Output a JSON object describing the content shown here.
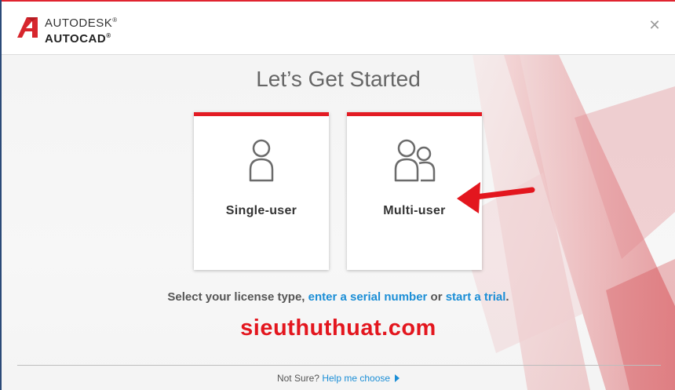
{
  "header": {
    "brand": "AUTODESK",
    "brand_mark": "®",
    "product": "AUTOCAD",
    "product_mark": "®",
    "close_icon": "close-icon"
  },
  "main": {
    "title": "Let’s Get Started",
    "cards": [
      {
        "label": "Single-user",
        "icon": "single-user-icon"
      },
      {
        "label": "Multi-user",
        "icon": "multi-user-icon"
      }
    ],
    "prompt": {
      "text": "Select your license type,",
      "serial_link": "enter a serial number",
      "or": "or",
      "trial_link": "start a trial",
      "end": "."
    }
  },
  "watermark": "sieuthuthuat.com",
  "footer": {
    "not_sure": "Not Sure?",
    "help_link": "Help me choose"
  },
  "colors": {
    "accent_red": "#e31b23",
    "link_blue": "#1b8ed6",
    "title_gray": "#666666"
  }
}
